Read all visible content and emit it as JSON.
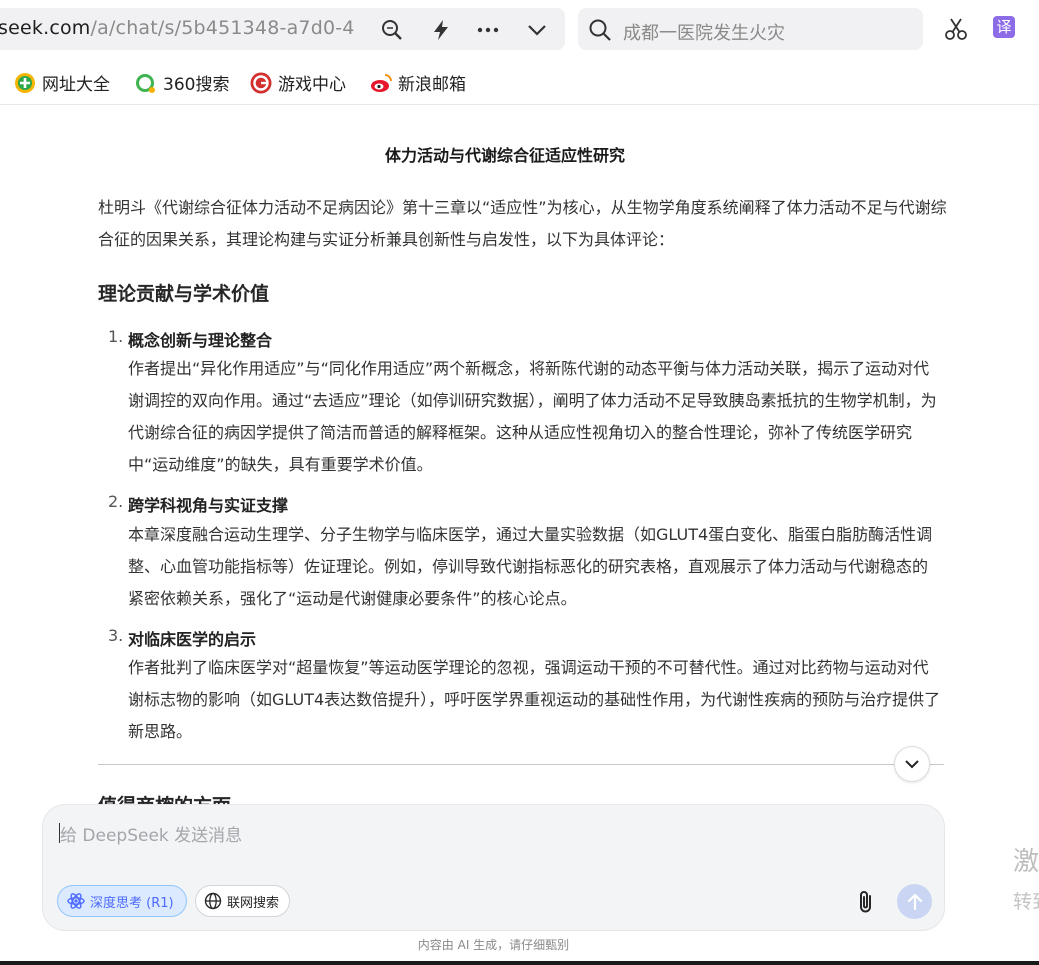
{
  "browser": {
    "url_domain": "seek.com",
    "url_path": "/a/chat/s/5b451348-a7d0-4",
    "search_placeholder": "成都一医院发生火灾",
    "translate_label": "译"
  },
  "bookmarks": [
    {
      "label": "网址大全",
      "icon": "wangzhi-icon"
    },
    {
      "label": "360搜索",
      "icon": "360-search-icon"
    },
    {
      "label": "游戏中心",
      "icon": "game-center-icon"
    },
    {
      "label": "新浪邮箱",
      "icon": "sina-mail-icon"
    }
  ],
  "article": {
    "title": "体力活动与代谢综合征适应性研究",
    "intro": "杜明斗《代谢综合征体力活动不足病因论》第十三章以“适应性”为核心，从生物学角度系统阐释了体力活动不足与代谢综合征的因果关系，其理论构建与实证分析兼具创新性与启发性，以下为具体评论：",
    "section1_heading": "理论贡献与学术价值",
    "items": [
      {
        "num": "1.",
        "title": "概念创新与理论整合",
        "body": "作者提出“异化作用适应”与“同化作用适应”两个新概念，将新陈代谢的动态平衡与体力活动关联，揭示了运动对代谢调控的双向作用。通过“去适应”理论（如停训研究数据），阐明了体力活动不足导致胰岛素抵抗的生物学机制，为代谢综合征的病因学提供了简洁而普适的解释框架。这种从适应性视角切入的整合性理论，弥补了传统医学研究中“运动维度”的缺失，具有重要学术价值。"
      },
      {
        "num": "2.",
        "title": "跨学科视角与实证支撑",
        "body": "本章深度融合运动生理学、分子生物学与临床医学，通过大量实验数据（如GLUT4蛋白变化、脂蛋白脂肪酶活性调整、心血管功能指标等）佐证理论。例如，停训导致代谢指标恶化的研究表格，直观展示了体力活动与代谢稳态的紧密依赖关系，强化了“运动是代谢健康必要条件”的核心论点。"
      },
      {
        "num": "3.",
        "title": "对临床医学的启示",
        "body": "作者批判了临床医学对“超量恢复”等运动医学理论的忽视，强调运动干预的不可替代性。通过对比药物与运动对代谢标志物的影响（如GLUT4表达数倍提升），呼吁医学界重视运动的基础性作用，为代谢性疾病的预防与治疗提供了新思路。"
      }
    ],
    "section2_heading": "值得商榷的方面"
  },
  "composer": {
    "placeholder": "给 DeepSeek 发送消息",
    "deep_think_label": "深度思考 (R1)",
    "web_search_label": "联网搜索"
  },
  "disclaimer": "内容由 AI 生成，请仔细甄别",
  "side_text": {
    "line1": "激",
    "line2": "转到"
  },
  "colors": {
    "accent": "#4d6bfe",
    "send_button": "#c9d5f2"
  }
}
